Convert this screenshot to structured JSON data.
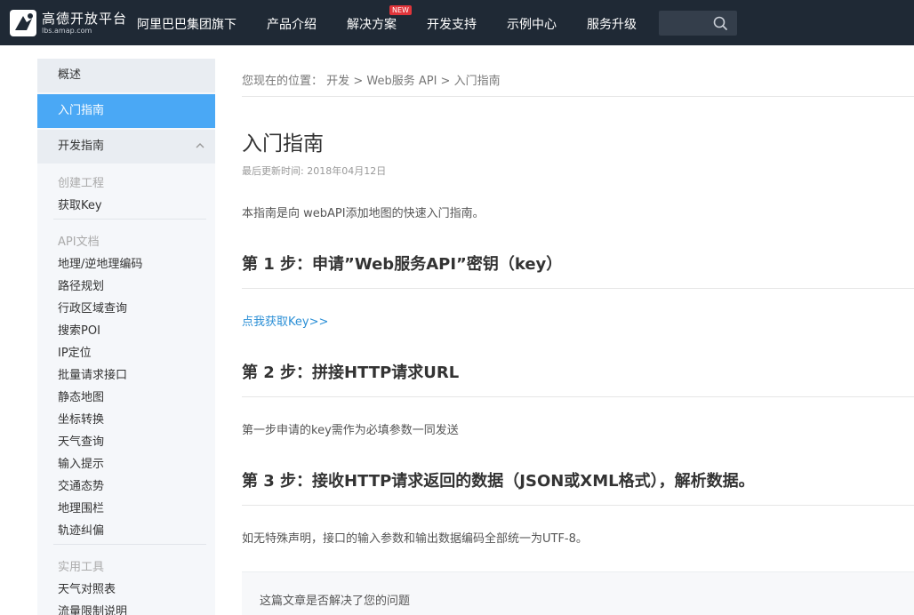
{
  "header": {
    "logo_title": "高德开放平台",
    "logo_subtitle": "lbs.amap.com",
    "nav": [
      {
        "label": "阿里巴巴集团旗下"
      },
      {
        "label": "产品介绍"
      },
      {
        "label": "解决方案",
        "badge": "NEW"
      },
      {
        "label": "开发支持"
      },
      {
        "label": "示例中心"
      },
      {
        "label": "服务升级"
      }
    ],
    "search_placeholder": "",
    "search_icon": "search-icon",
    "colors": {
      "bar": "#1f2935",
      "badge": "#e0353b"
    }
  },
  "sidebar": {
    "overview": "概述",
    "active": "入门指南",
    "dev_guide": "开发指南",
    "groups": [
      {
        "title": "创建工程",
        "items": [
          "获取Key"
        ]
      },
      {
        "title": "API文档",
        "items": [
          "地理/逆地理编码",
          "路径规划",
          "行政区域查询",
          "搜索POI",
          "IP定位",
          "批量请求接口",
          "静态地图",
          "坐标转换",
          "天气查询",
          "输入提示",
          "交通态势",
          "地理围栏",
          "轨迹纠偏"
        ]
      },
      {
        "title": "实用工具",
        "items": [
          "天气对照表",
          "流量限制说明"
        ]
      }
    ],
    "colors": {
      "active_bg": "#4aa8f5"
    }
  },
  "main": {
    "breadcrumb": {
      "prefix": "您现在的位置：",
      "items": [
        "开发",
        "Web服务 API",
        "入门指南"
      ],
      "separator": ">"
    },
    "title": "入门指南",
    "updated": "最后更新时间: 2018年04月12日",
    "intro": "本指南是向 webAPI添加地图的快速入门指南。",
    "step1": "第 1 步：申请”Web服务API”密钥（key）",
    "step1_link": "点我获取Key>>",
    "step2": "第 2 步：拼接HTTP请求URL",
    "step2_text": "第一步申请的key需作为必填参数一同发送",
    "step3": "第 3 步：接收HTTP请求返回的数据（JSON或XML格式），解析数据。",
    "step3_text": "如无特殊声明，接口的输入参数和输出数据编码全部统一为UTF-8。",
    "feedback_question": "这篇文章是否解决了您的问题",
    "colors": {
      "link": "#2b8fd6"
    }
  }
}
